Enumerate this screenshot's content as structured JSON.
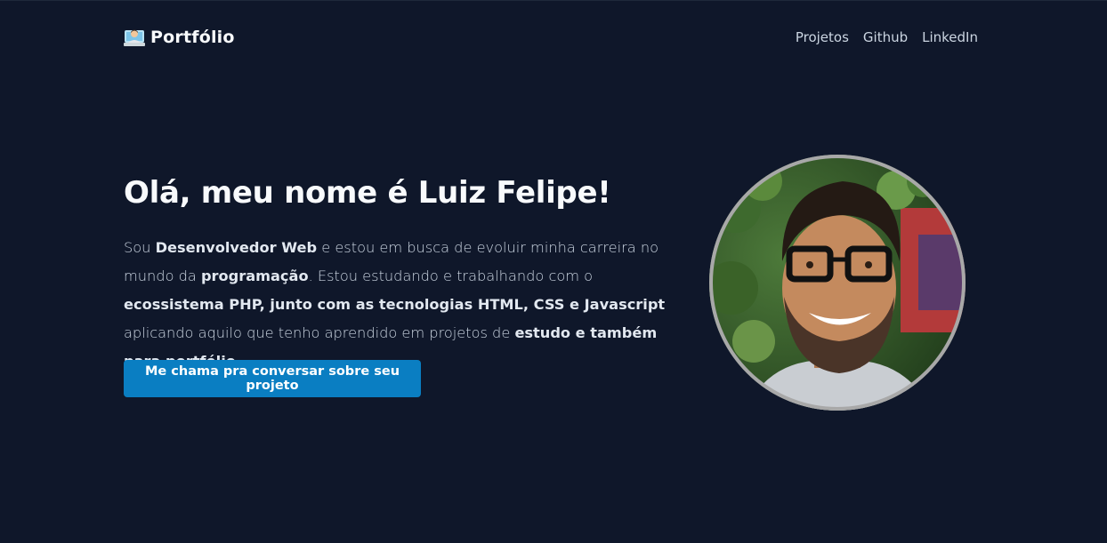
{
  "header": {
    "brand": "Portfólio",
    "brand_icon": "technologist-icon",
    "nav": [
      {
        "label": "Projetos"
      },
      {
        "label": "Github"
      },
      {
        "label": "LinkedIn"
      }
    ]
  },
  "hero": {
    "title": "Olá, meu nome é Luiz Felipe!",
    "paragraph": [
      {
        "text": "Sou ",
        "bold": false
      },
      {
        "text": "Desenvolvedor Web",
        "bold": true
      },
      {
        "text": " e estou em busca de evoluir minha carreira no mundo da ",
        "bold": false
      },
      {
        "text": "programação",
        "bold": true
      },
      {
        "text": ". Estou estudando e trabalhando com o ",
        "bold": false
      },
      {
        "text": "ecossistema PHP, junto com as tecnologias HTML, CSS e Javascript",
        "bold": true
      },
      {
        "text": " aplicando aquilo que tenho aprendido em projetos de ",
        "bold": false
      },
      {
        "text": "estudo e também para portfólio",
        "bold": true
      },
      {
        "text": ".",
        "bold": false
      }
    ],
    "cta_label": "Me chama pra conversar sobre seu projeto"
  },
  "colors": {
    "background": "#0f172a",
    "accent": "#0a7ec2",
    "heading": "#f8fafc",
    "text": "#cbd5e1"
  }
}
